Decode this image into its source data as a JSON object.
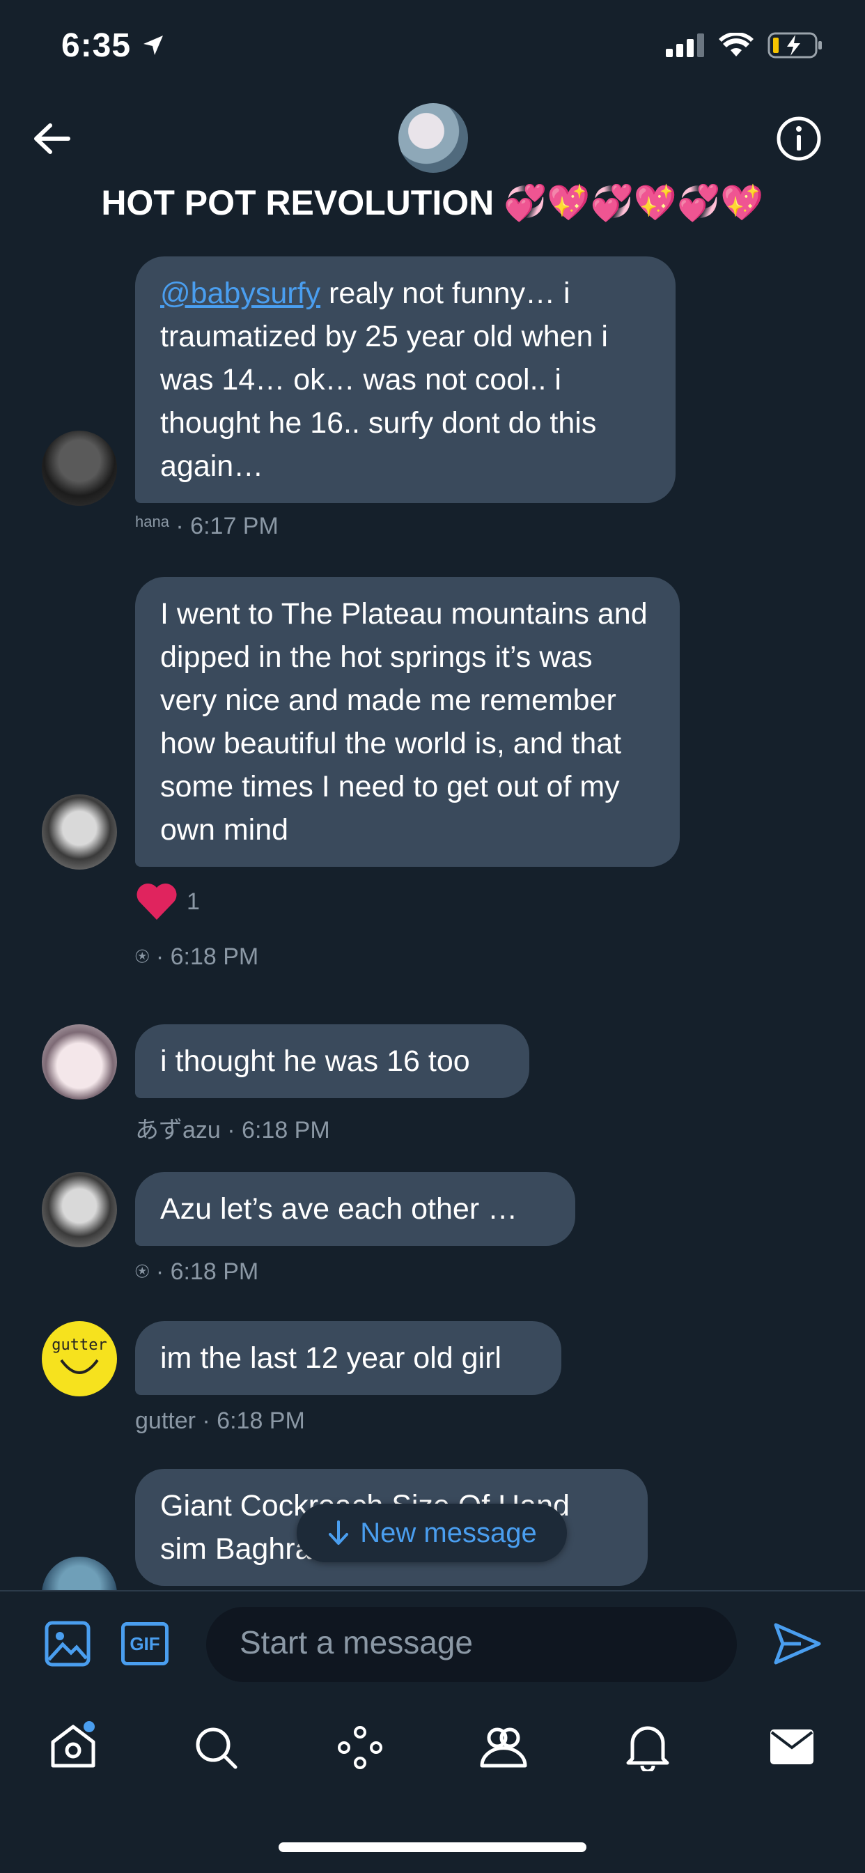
{
  "status_bar": {
    "time": "6:35"
  },
  "header": {
    "title": "HOT POT REVOLUTION 💞💖💞💖💞💖"
  },
  "messages": [
    {
      "mention": "@babysurfy",
      "text": " realy not funny… i traumatized by 25 year old when i was 14… ok… was not cool.. i thought he 16.. surfy dont do this again…",
      "sender": "hana",
      "time": "· 6:17 PM"
    },
    {
      "text": "I went to The Plateau mountains and dipped in the hot springs it’s was very nice and made me remember how beautiful the world is, and that some times I need to get out of my own mind",
      "reaction_count": "1",
      "sender": "⍟",
      "time": "· 6:18 PM"
    },
    {
      "text": "i thought he was 16 too",
      "sender": "あずazu",
      "time": "· 6:18 PM"
    },
    {
      "text": "Azu let’s ave each other …",
      "sender": "⍟",
      "time": "· 6:18 PM"
    },
    {
      "text": "im the last 12 year old girl",
      "sender": "gutter",
      "time": "· 6:18 PM",
      "avatar_text": "gutter"
    },
    {
      "text": "Giant Cockroach Size Of Hand sim Baghratunnel food Fvck"
    }
  ],
  "new_message_label": "New message",
  "composer": {
    "placeholder": "Start a message",
    "gif_label": "GIF"
  },
  "colors": {
    "background": "#15202b",
    "bubble": "#3a4a5c",
    "accent": "#4a9eef",
    "muted": "#8b98a5"
  }
}
